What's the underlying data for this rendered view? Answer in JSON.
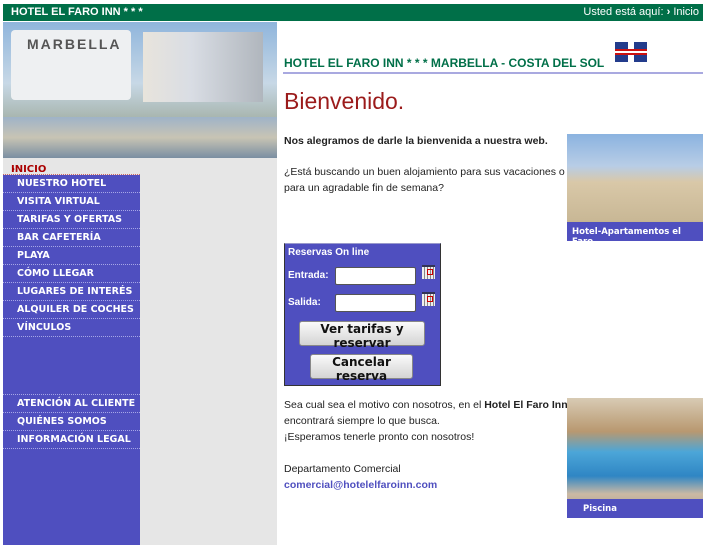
{
  "topbar": {
    "title": "HOTEL EL FARO INN * * *",
    "breadcrumb_prefix": "Usted está aquí:",
    "breadcrumb_current": "Inicio"
  },
  "header_image": {
    "sign_text": "MARBELLA"
  },
  "sidebar": {
    "active": "INICIO",
    "items": [
      "NUESTRO HOTEL",
      "VISITA VIRTUAL",
      "TARIFAS Y OFERTAS",
      "BAR CAFETERÍA",
      "PLAYA",
      "CÓMO LLEGAR",
      "LUGARES DE INTERÉS",
      "ALQUILER DE COCHES",
      "VÍNCULOS"
    ],
    "bottom_items": [
      "ATENCIÓN AL CLIENTE",
      "QUIÉNES SOMOS",
      "INFORMACIÓN LEGAL"
    ]
  },
  "main": {
    "title": "HOTEL EL FARO INN * * * MARBELLA - COSTA DEL SOL",
    "welcome": "Bienvenido.",
    "intro_bold": "Nos alegramos de darle la bienvenida a nuestra web.",
    "question_1": "¿Está buscando un buen alojamiento para sus vacaciones o",
    "question_2": "para un agradable fin de semana?",
    "p1_a": "Sea cual sea el motivo con nosotros, en el ",
    "p1_bold": "Hotel El Faro Inn",
    "p1_b": ",",
    "p2": "encontrará siempre lo que busca.",
    "p3": "¡Esperamos tenerle pronto con nosotros!",
    "dept": "Departamento Comercial",
    "email": "comercial@hotelelfaroinn.com",
    "img1_caption": "Hotel-Apartamentos el Faro",
    "img2_caption": "Piscina"
  },
  "booking": {
    "title": "Reservas On line",
    "checkin_label": "Entrada:",
    "checkout_label": "Salida:",
    "checkin_value": "",
    "checkout_value": "",
    "submit": "Ver tarifas y reservar",
    "cancel": "Cancelar reserva"
  }
}
